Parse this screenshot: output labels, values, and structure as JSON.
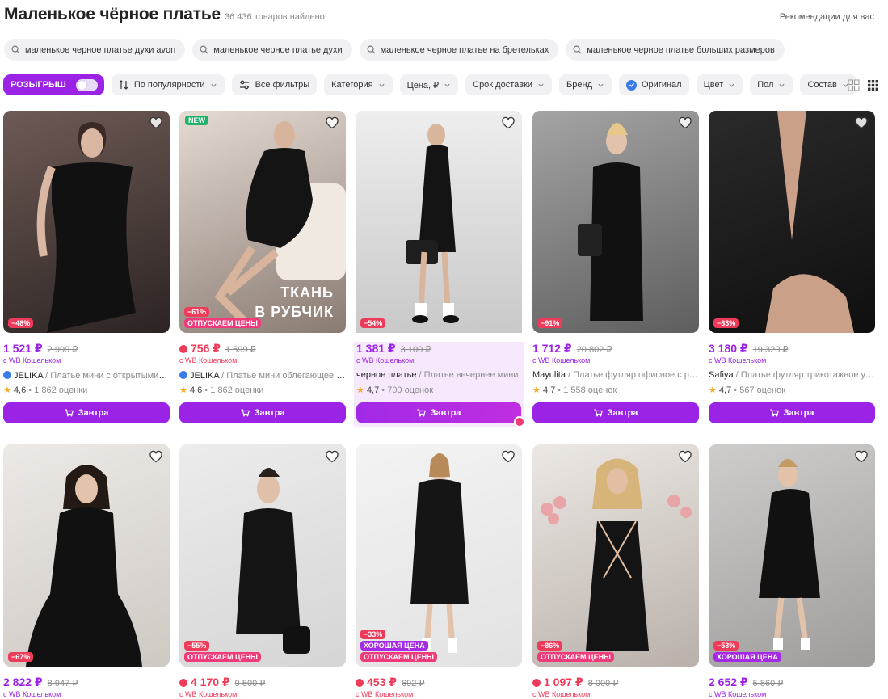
{
  "header": {
    "title": "Маленькое чёрное платье",
    "count": "36 436 товаров найдено",
    "recommendations": "Рекомендации для вас"
  },
  "suggestions": [
    "маленькое черное платье духи avon",
    "маленькое черное платье духи",
    "маленькое черное платье на бретельках",
    "маленькое черное платье больших размеров"
  ],
  "filters": {
    "promo": "РОЗЫГРЫШ",
    "sort": "По популярности",
    "all_filters": "Все фильтры",
    "category": "Категория",
    "price": "Цена, ₽",
    "delivery": "Срок доставки",
    "brand": "Бренд",
    "original": "Оригинал",
    "color": "Цвет",
    "gender": "Пол",
    "composition": "Состав"
  },
  "buy_label": "Завтра",
  "products": [
    {
      "price": "1 521 ₽",
      "old_price": "2 999 ₽",
      "wallet": "с WB Кошельком",
      "brand": "JELIKA",
      "desc": " / Платье мини с открытыми п...",
      "rating": "4,6",
      "reviews": " • 1 862 оценки",
      "discount": "−48%",
      "tag": "",
      "new": "",
      "overlay": [
        "",
        ""
      ],
      "bg": [
        "#6e5a55",
        "#2b2423"
      ]
    },
    {
      "price": "756 ₽",
      "old_price": "1 599 ₽",
      "wallet": "с WB Кошельком",
      "brand": "JELIKA",
      "desc": " / Платье мини облегающее И...",
      "rating": "4,6",
      "reviews": " • 1 862 оценки",
      "discount": "−61%",
      "tag": "ОТПУСКАЕМ ЦЕНЫ",
      "new": "NEW",
      "overlay": [
        "ТКАНЬ",
        "В РУБЧИК"
      ],
      "bg": [
        "#d9cfc7",
        "#8a7b72"
      ]
    },
    {
      "price": "1 381 ₽",
      "old_price": "3 100 ₽",
      "wallet": "с WB Кошельком",
      "brand": "черное платье",
      "desc": " / Платье вечернее мини",
      "rating": "4,7",
      "reviews": " • 700 оценок",
      "discount": "−54%",
      "tag": "",
      "new": "",
      "overlay": [
        "",
        ""
      ],
      "bg": [
        "#e9e9e9",
        "#c8c8c8"
      ]
    },
    {
      "price": "1 712 ₽",
      "old_price": "20 802 ₽",
      "wallet": "с WB Кошельком",
      "brand": "Mayulita",
      "desc": " / Платье футляр офисное с раз...",
      "rating": "4,7",
      "reviews": " • 1 558 оценок",
      "discount": "−91%",
      "tag": "",
      "new": "",
      "overlay": [
        "",
        ""
      ],
      "bg": [
        "#9c9c9c",
        "#5e5e5e"
      ]
    },
    {
      "price": "3 180 ₽",
      "old_price": "19 320 ₽",
      "wallet": "с WB Кошельком",
      "brand": "Safiya",
      "desc": " / Платье футляр трикотажное утя...",
      "rating": "4,7",
      "reviews": " • 567 оценок",
      "discount": "−83%",
      "tag": "",
      "new": "",
      "overlay": [
        "",
        ""
      ],
      "bg": [
        "#2a2a2a",
        "#0f0f0f"
      ]
    },
    {
      "price": "2 822 ₽",
      "old_price": "8 947 ₽",
      "wallet": "с WB Кошельком",
      "discount": "−67%",
      "tag": "",
      "tag2": "",
      "bg": [
        "#ece9e6",
        "#cfc9c3"
      ]
    },
    {
      "price": "4 170 ₽",
      "old_price": "9 500 ₽",
      "wallet": "с WB Кошельком",
      "discount": "−55%",
      "tag": "ОТПУСКАЕМ ЦЕНЫ",
      "tag2": "",
      "bg": [
        "#ececec",
        "#d5d5d5"
      ]
    },
    {
      "price": "453 ₽",
      "old_price": "692 ₽",
      "wallet": "с WB Кошельком",
      "discount": "−33%",
      "tag": "ОТПУСКАЕМ ЦЕНЫ",
      "tag2": "ХОРОШАЯ ЦЕНА",
      "bg": [
        "#f3f3f3",
        "#e2e2e2"
      ]
    },
    {
      "price": "1 097 ₽",
      "old_price": "8 000 ₽",
      "wallet": "с WB Кошельком",
      "discount": "−86%",
      "tag": "ОТПУСКАЕМ ЦЕНЫ",
      "tag2": "",
      "bg": [
        "#e8e4e0",
        "#b9b0aa"
      ]
    },
    {
      "price": "2 652 ₽",
      "old_price": "5 860 ₽",
      "wallet": "с WB Кошельком",
      "discount": "−53%",
      "tag": "",
      "tag2": "ХОРОШАЯ ЦЕНА",
      "bg": [
        "#c9c7c6",
        "#9f9d9c"
      ]
    }
  ]
}
